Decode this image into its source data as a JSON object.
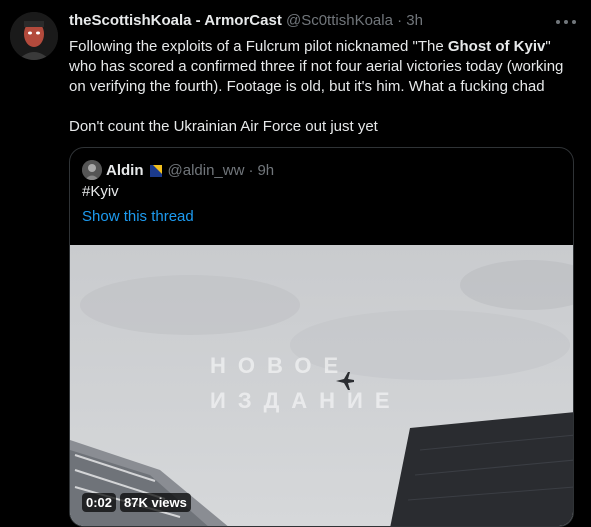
{
  "tweet": {
    "display_name": "theScottishKoala - ArmorCast",
    "handle": "@Sc0ttishKoala",
    "separator": "·",
    "time": "3h",
    "line1_pre": "Following the exploits of a Fulcrum pilot nicknamed \"The ",
    "line1_bold": "Ghost of Kyiv",
    "line1_post": "\" who has scored a confirmed three if not four aerial victories today (working on verifying the fourth). Footage is old, but it's him. What a fucking chad",
    "line2": "Don't count the Ukrainian Air Force out just yet"
  },
  "quoted": {
    "display_name": "Aldin",
    "handle": "@aldin_ww",
    "separator": "·",
    "time": "9h",
    "text": "#Kyiv",
    "show_thread": "Show this thread",
    "watermark_line1": "НОВОЕ",
    "watermark_line2": "ИЗДАНИЕ",
    "video_time": "0:02",
    "views": "87K views"
  },
  "colors": {
    "background": "#000000",
    "text": "#e7e9ea",
    "muted": "#71767b",
    "link": "#1d9bf0",
    "border": "#2f3336"
  },
  "icons": [
    "more-icon",
    "flag-icon",
    "fighter-jet-icon"
  ]
}
